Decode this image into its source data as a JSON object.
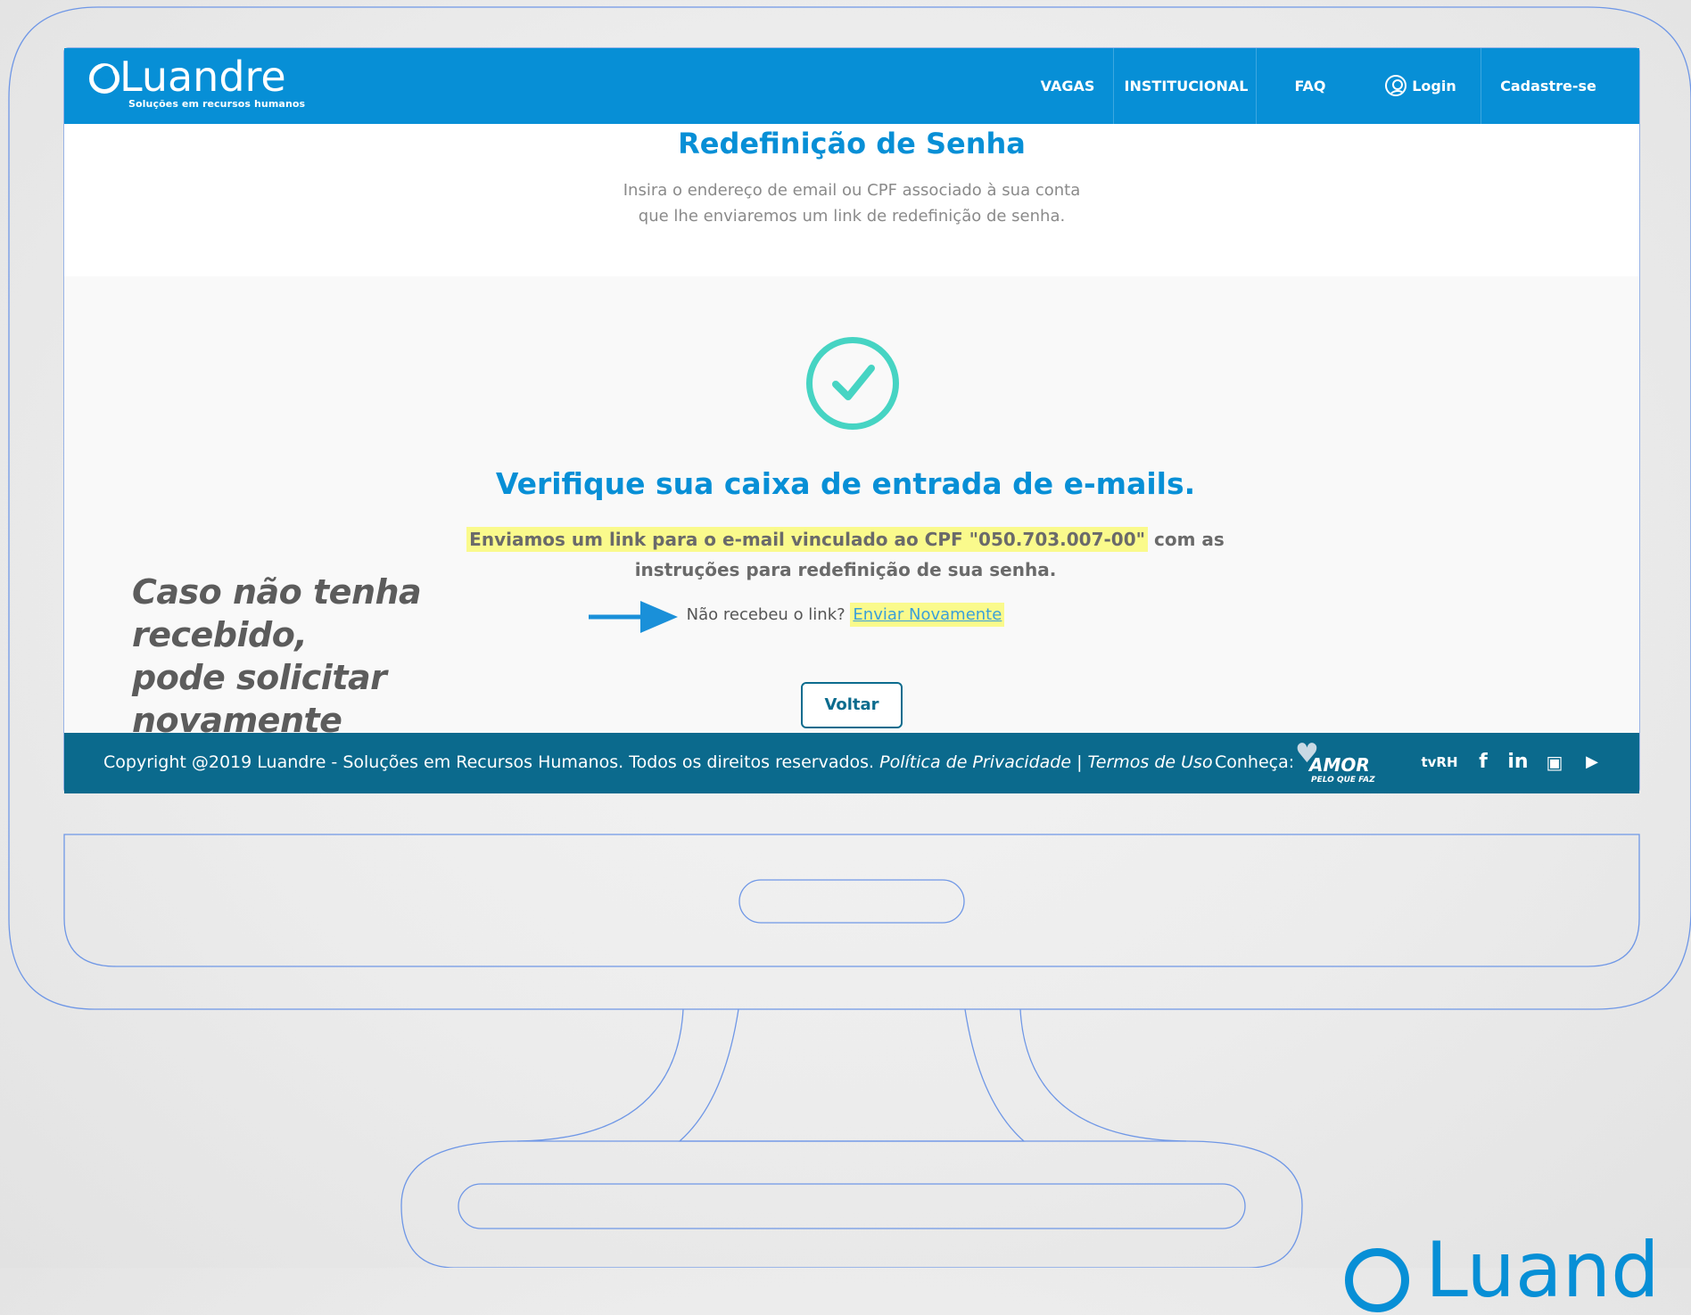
{
  "brand": {
    "name": "Luandre",
    "tagline": "Soluções em recursos humanos",
    "primary_color": "#078fd6",
    "footer_color": "#0b6a8d",
    "accent_check_color": "#46d4c3",
    "highlight_color": "#fafa8c"
  },
  "nav": {
    "items": [
      {
        "label": "VAGAS"
      },
      {
        "label": "INSTITUCIONAL"
      },
      {
        "label": "FAQ"
      },
      {
        "label": "Login",
        "icon": "user-icon"
      },
      {
        "label": "Cadastre-se"
      }
    ]
  },
  "header": {
    "title": "Redefinição de Senha",
    "subtitle_line1": "Insira o endereço de email ou CPF associado à sua conta",
    "subtitle_line2": "que lhe enviaremos um link de redefinição de senha."
  },
  "confirmation": {
    "icon": "check-circle-icon",
    "title": "Verifique sua caixa de entrada de e-mails.",
    "text_highlighted": "Enviamos um link para o e-mail vinculado ao CPF \"050.703.007-00\"",
    "text_rest": " com as",
    "text_line2": "instruções para redefinição de sua senha.",
    "resend_question": "Não recebeu o link? ",
    "resend_link": "Enviar Novamente",
    "back_button": "Voltar"
  },
  "annotation": {
    "line1": "Caso não tenha recebido,",
    "line2": "pode solicitar novamente"
  },
  "footer": {
    "copyright": "Copyright @2019 Luandre - Soluções em Recursos Humanos. Todos os direitos reservados. ",
    "privacy_link": "Política de Privacidade",
    "separator": " | ",
    "terms_link": "Termos de Uso",
    "know_label": "Conheça:",
    "amor_logo": {
      "word": "AMOR",
      "sub": "PELO QUE FAZ"
    },
    "social": [
      {
        "icon": "tvrh-icon",
        "label": "tvRH"
      },
      {
        "icon": "facebook-icon",
        "label": "f"
      },
      {
        "icon": "linkedin-icon",
        "label": "in"
      },
      {
        "icon": "instagram-icon",
        "label": "▣"
      },
      {
        "icon": "youtube-icon",
        "label": "▶"
      }
    ]
  },
  "corner_brand": {
    "text": "Luand"
  }
}
